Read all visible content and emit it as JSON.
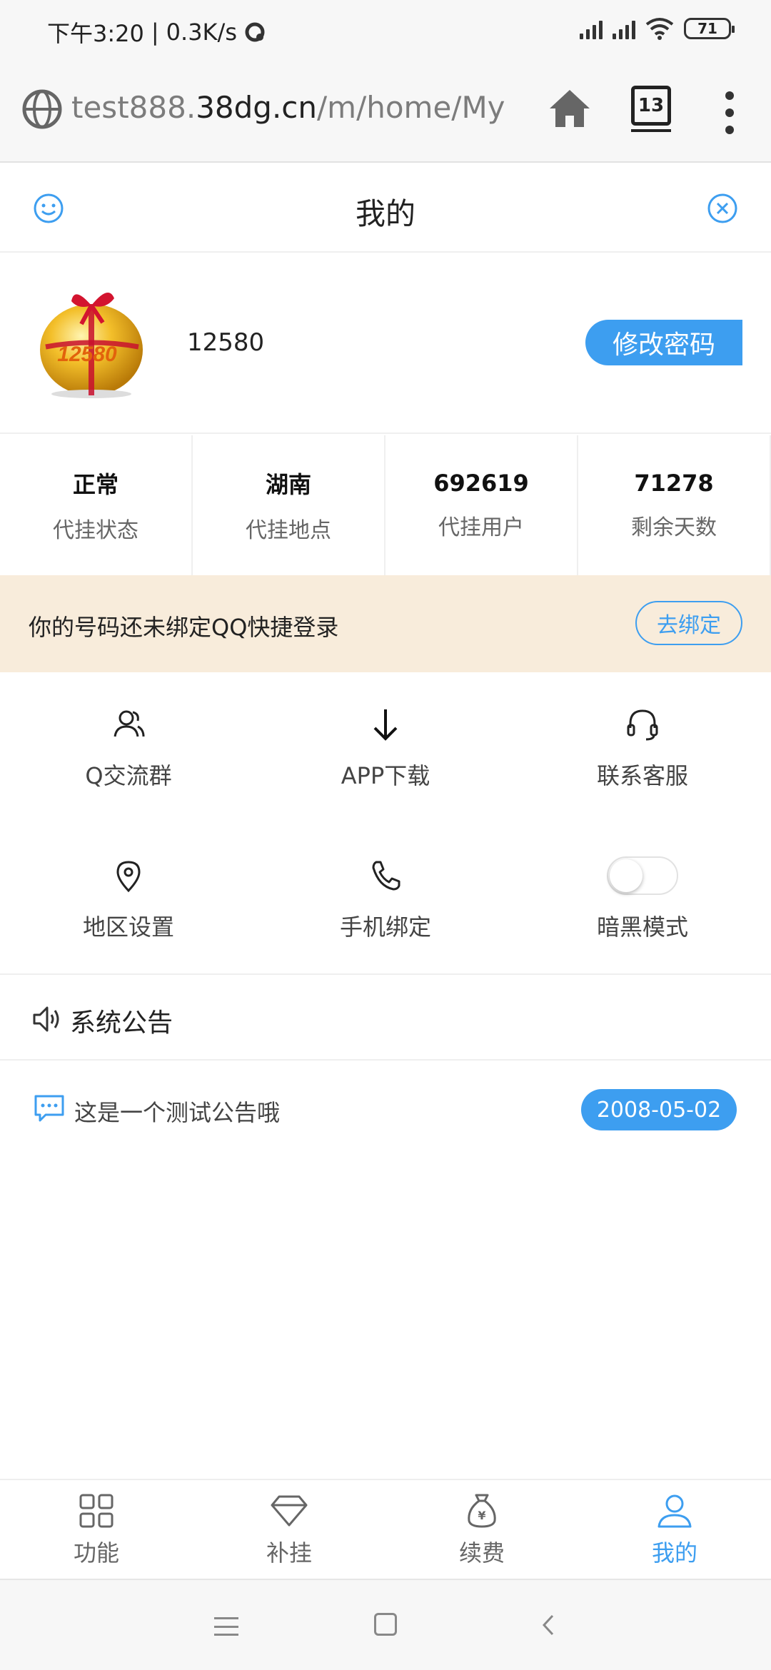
{
  "status_bar": {
    "time": "下午3:20",
    "separator": "|",
    "net_speed": "0.3K/s",
    "battery": "71"
  },
  "browser": {
    "url_prefix": "test888.",
    "url_host": "38dg.cn",
    "url_path": "/m/home/My",
    "tab_count": "13"
  },
  "header": {
    "title": "我的"
  },
  "profile": {
    "username": "12580",
    "change_password_label": "修改密码"
  },
  "stats": [
    {
      "value": "正常",
      "label": "代挂状态"
    },
    {
      "value": "湖南",
      "label": "代挂地点"
    },
    {
      "value": "692619",
      "label": "代挂用户"
    },
    {
      "value": "71278",
      "label": "剩余天数"
    }
  ],
  "bind_banner": {
    "text": "你的号码还未绑定QQ快捷登录",
    "button_label": "去绑定"
  },
  "grid": [
    {
      "label": "Q交流群",
      "icon": "users-icon"
    },
    {
      "label": "APP下载",
      "icon": "download-arrow-icon"
    },
    {
      "label": "联系客服",
      "icon": "headset-icon"
    },
    {
      "label": "地区设置",
      "icon": "location-pin-icon"
    },
    {
      "label": "手机绑定",
      "icon": "phone-icon"
    },
    {
      "label": "暗黑模式",
      "icon": "toggle-switch",
      "toggle_on": false
    }
  ],
  "notice": {
    "title": "系统公告",
    "items": [
      {
        "text": "这是一个测试公告哦",
        "date": "2008-05-02"
      }
    ]
  },
  "bottom_nav": [
    {
      "label": "功能",
      "icon": "grid-icon",
      "active": false
    },
    {
      "label": "补挂",
      "icon": "diamond-icon",
      "active": false
    },
    {
      "label": "续费",
      "icon": "money-bag-icon",
      "active": false
    },
    {
      "label": "我的",
      "icon": "user-icon",
      "active": true
    }
  ],
  "colors": {
    "accent": "#3d9ef0",
    "banner_bg": "#f8ecdb"
  }
}
